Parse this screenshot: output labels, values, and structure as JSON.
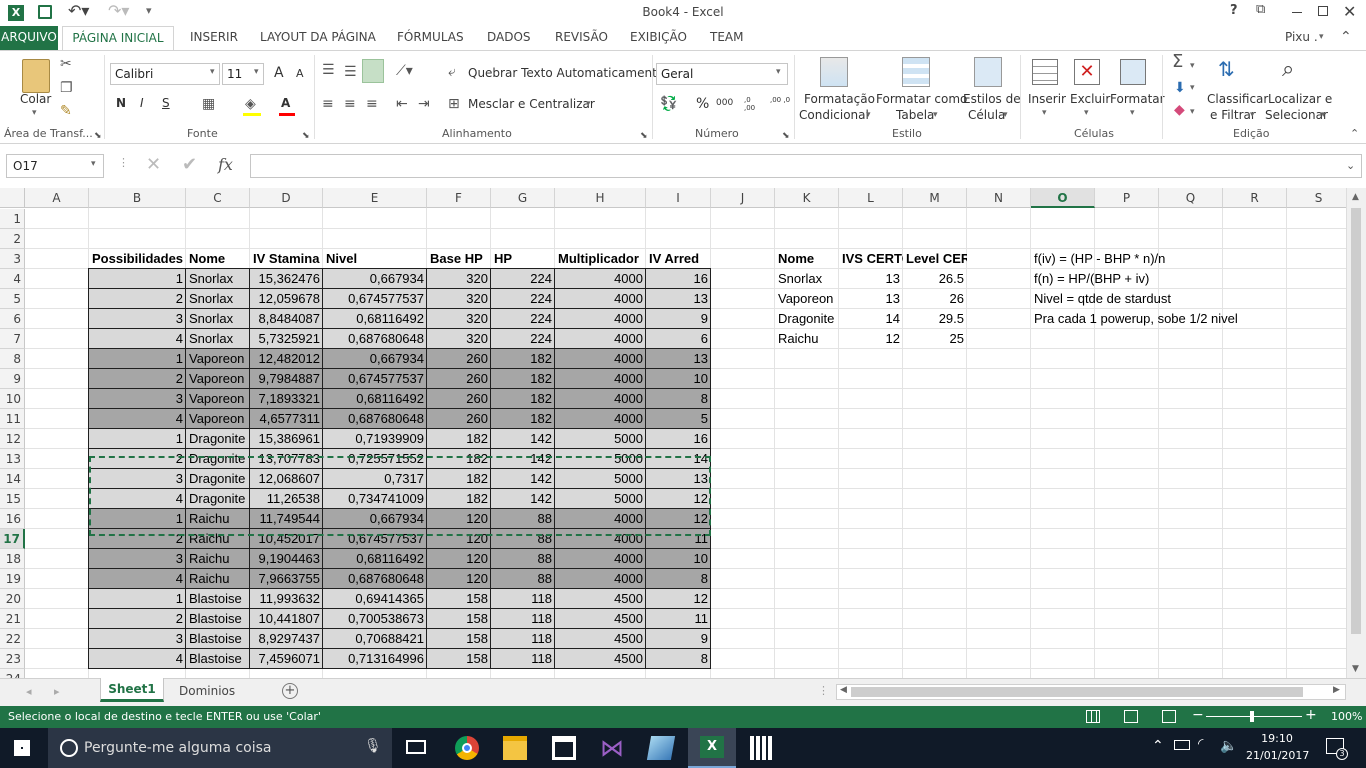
{
  "app": {
    "title": "Book4 - Excel",
    "user": "Pixu ."
  },
  "tabs": [
    "ARQUIVO",
    "PÁGINA INICIAL",
    "INSERIR",
    "LAYOUT DA PÁGINA",
    "FÓRMULAS",
    "DADOS",
    "REVISÃO",
    "EXIBIÇÃO",
    "TEAM"
  ],
  "ribbon": {
    "paste_label": "Colar",
    "font_name": "Calibri",
    "font_size": "11",
    "wrap_text": "Quebrar Texto Automaticamente",
    "merge_center": "Mesclar e Centralizar",
    "number_format": "Geral",
    "cond_format": [
      "Formatação",
      "Condicional"
    ],
    "format_table": [
      "Formatar como",
      "Tabela"
    ],
    "cell_styles": [
      "Estilos de",
      "Célula"
    ],
    "insert": "Inserir",
    "delete": "Excluir",
    "format": "Formatar",
    "sort_filter": [
      "Classificar",
      "e Filtrar"
    ],
    "find_select": [
      "Localizar e",
      "Selecionar"
    ],
    "groups": [
      "Área de Transf...",
      "Fonte",
      "Alinhamento",
      "Número",
      "Estilo",
      "Células",
      "Edição"
    ],
    "bold": "N",
    "italic": "I",
    "underline": "S",
    "font_grow": "A",
    "font_shrink": "A",
    "percent": "%",
    "thousands": "000",
    "dec_more": ",0 ,00",
    "dec_less": ",00 ,0"
  },
  "formula_bar": {
    "name_box": "O17",
    "fx": "fx",
    "content": ""
  },
  "columns": [
    "A",
    "B",
    "C",
    "D",
    "E",
    "F",
    "G",
    "H",
    "I",
    "J",
    "K",
    "L",
    "M",
    "N",
    "O",
    "P",
    "Q",
    "R",
    "S"
  ],
  "rows": [
    "1",
    "2",
    "3",
    "4",
    "5",
    "6",
    "7",
    "8",
    "9",
    "10",
    "11",
    "12",
    "13",
    "14",
    "15",
    "16",
    "17",
    "18",
    "19",
    "20",
    "21",
    "22",
    "23",
    "24"
  ],
  "table": {
    "headers": [
      "Possibilidades",
      "Nome",
      "IV Stamina",
      "Nivel",
      "Base HP",
      "HP",
      "Multiplicador",
      "IV Arred"
    ],
    "rows": [
      [
        "1",
        "Snorlax",
        "15,362476",
        "0,667934",
        "320",
        "224",
        "4000",
        "16"
      ],
      [
        "2",
        "Snorlax",
        "12,059678",
        "0,674577537",
        "320",
        "224",
        "4000",
        "13"
      ],
      [
        "3",
        "Snorlax",
        "8,8484087",
        "0,68116492",
        "320",
        "224",
        "4000",
        "9"
      ],
      [
        "4",
        "Snorlax",
        "5,7325921",
        "0,687680648",
        "320",
        "224",
        "4000",
        "6"
      ],
      [
        "1",
        "Vaporeon",
        "12,482012",
        "0,667934",
        "260",
        "182",
        "4000",
        "13"
      ],
      [
        "2",
        "Vaporeon",
        "9,7984887",
        "0,674577537",
        "260",
        "182",
        "4000",
        "10"
      ],
      [
        "3",
        "Vaporeon",
        "7,1893321",
        "0,68116492",
        "260",
        "182",
        "4000",
        "8"
      ],
      [
        "4",
        "Vaporeon",
        "4,6577311",
        "0,687680648",
        "260",
        "182",
        "4000",
        "5"
      ],
      [
        "1",
        "Dragonite",
        "15,386961",
        "0,71939909",
        "182",
        "142",
        "5000",
        "16"
      ],
      [
        "2",
        "Dragonite",
        "13,707783",
        "0,725571552",
        "182",
        "142",
        "5000",
        "14"
      ],
      [
        "3",
        "Dragonite",
        "12,068607",
        "0,7317",
        "182",
        "142",
        "5000",
        "13"
      ],
      [
        "4",
        "Dragonite",
        "11,26538",
        "0,734741009",
        "182",
        "142",
        "5000",
        "12"
      ],
      [
        "1",
        "Raichu",
        "11,749544",
        "0,667934",
        "120",
        "88",
        "4000",
        "12"
      ],
      [
        "2",
        "Raichu",
        "10,452017",
        "0,674577537",
        "120",
        "88",
        "4000",
        "11"
      ],
      [
        "3",
        "Raichu",
        "9,1904463",
        "0,68116492",
        "120",
        "88",
        "4000",
        "10"
      ],
      [
        "4",
        "Raichu",
        "7,9663755",
        "0,687680648",
        "120",
        "88",
        "4000",
        "8"
      ],
      [
        "1",
        "Blastoise",
        "11,993632",
        "0,69414365",
        "158",
        "118",
        "4500",
        "12"
      ],
      [
        "2",
        "Blastoise",
        "10,441807",
        "0,700538673",
        "158",
        "118",
        "4500",
        "11"
      ],
      [
        "3",
        "Blastoise",
        "8,9297437",
        "0,70688421",
        "158",
        "118",
        "4500",
        "9"
      ],
      [
        "4",
        "Blastoise",
        "7,4596071",
        "0,713164996",
        "158",
        "118",
        "4500",
        "8"
      ]
    ],
    "row_shades": [
      "light",
      "light",
      "light",
      "light",
      "dark",
      "dark",
      "dark",
      "dark",
      "light",
      "light",
      "light",
      "light",
      "dark",
      "dark",
      "dark",
      "dark",
      "light",
      "light",
      "light",
      "light"
    ]
  },
  "side_table": {
    "headers": [
      "Nome",
      "IVS CERTO",
      "Level CERTO"
    ],
    "rows": [
      [
        "Snorlax",
        "13",
        "26.5"
      ],
      [
        "Vaporeon",
        "13",
        "26"
      ],
      [
        "Dragonite",
        "14",
        "29.5"
      ],
      [
        "Raichu",
        "12",
        "25"
      ]
    ]
  },
  "notes": [
    "f(iv) = (HP - BHP * n)/n",
    "f(n) = HP/(BHP + iv)",
    "Nivel = qtde de stardust",
    "Pra cada 1 powerup, sobe 1/2 nivel"
  ],
  "sheets": [
    "Sheet1",
    "Dominios"
  ],
  "status": {
    "message": "Selecione o local de destino e tecle ENTER ou use 'Colar'",
    "zoom": "100%"
  },
  "taskbar": {
    "search": "Pergunte-me alguma coisa",
    "time": "19:10",
    "date": "21/01/2017",
    "notifications": "3"
  },
  "colors": {
    "excel_green": "#217346",
    "light_fill": "#d9d9d9",
    "dark_fill": "#a6a6a6"
  },
  "titlebar_buttons": {
    "help": "?",
    "ribbon_options": "⧉"
  }
}
